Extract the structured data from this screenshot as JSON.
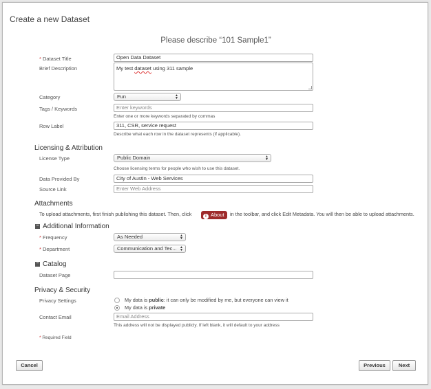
{
  "dialog": {
    "title": "Create a new Dataset",
    "subtitle": "Please describe “101 Sample1”"
  },
  "required_marker": "*",
  "fields": {
    "dataset_title": {
      "label": "Dataset Title",
      "value": "Open Data Dataset"
    },
    "brief_description": {
      "label": "Brief Description",
      "value_before": "My test ",
      "value_squiggle": "dataset",
      "value_after": " using 311 sample"
    },
    "category": {
      "label": "Category",
      "value": "Fun"
    },
    "tags": {
      "label": "Tags / Keywords",
      "placeholder": "Enter keywords",
      "hint": "Enter one or more keywords separated by commas"
    },
    "row_label": {
      "label": "Row Label",
      "value": "311, CSR, service request",
      "hint": "Describe what each row in the dataset represents (if applicable)."
    }
  },
  "licensing": {
    "heading": "Licensing & Attribution",
    "license_type": {
      "label": "License Type",
      "value": "Public Domain",
      "hint": "Choose licensing terms for people who wish to use this dataset."
    },
    "data_provided_by": {
      "label": "Data Provided By",
      "value": "City of Austin - Web Services"
    },
    "source_link": {
      "label": "Source Link",
      "placeholder": "Enter Web Address"
    }
  },
  "attachments": {
    "heading": "Attachments",
    "text_before": "To upload attachments, first finish publishing this dataset. Then, click",
    "about_label": "About",
    "text_after": "in the toolbar, and click Edit Metadata. You will then be able to upload attachments."
  },
  "additional": {
    "heading": "Additional Information",
    "collapse_symbol": "−",
    "frequency": {
      "label": "Frequency",
      "value": "As Needed"
    },
    "department": {
      "label": "Department",
      "value": "Communication and Tec..."
    }
  },
  "catalog": {
    "heading": "Catalog",
    "collapse_symbol": "−",
    "dataset_page": {
      "label": "Dataset Page",
      "value": ""
    }
  },
  "privacy": {
    "heading": "Privacy & Security",
    "settings_label": "Privacy Settings",
    "option_public": {
      "prefix": "My data is ",
      "bold": "public",
      "suffix": ": it can only be modified by me, but everyone can view it",
      "selected": false
    },
    "option_private": {
      "prefix": "My data is ",
      "bold": "private",
      "selected": true
    },
    "contact_email": {
      "label": "Contact Email",
      "placeholder": "Email Address",
      "hint": "This address will not be displayed publicly. If left blank, it will default to your address"
    }
  },
  "required_note": "Required Field",
  "buttons": {
    "cancel": "Cancel",
    "previous": "Previous",
    "next": "Next"
  },
  "colors": {
    "about_badge": "#9e2a2b",
    "required": "#cc3333"
  }
}
